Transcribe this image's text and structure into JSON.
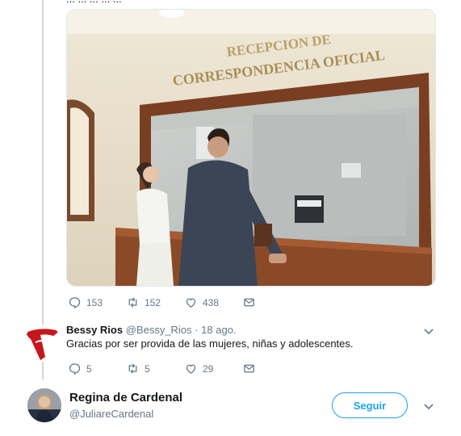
{
  "first_tweet": {
    "cut_text": "... ... ... ... ...",
    "photo": {
      "sign_line1": "RECEPCION DE",
      "sign_line2": "CORRESPONDENCIA OFICIAL"
    },
    "actions": {
      "replies": "153",
      "retweets": "152",
      "likes": "438"
    }
  },
  "reply": {
    "name": "Bessy Rios",
    "handle": "@Bessy_Rios",
    "separator": "·",
    "date": "18 ago.",
    "text": "Gracias por ser provida de las mujeres, niñas y adolescentes.",
    "actions": {
      "replies": "5",
      "retweets": "5",
      "likes": "29"
    },
    "accent_color": "#c8161d"
  },
  "account": {
    "name": "Regina de Cardenal",
    "handle": "@JuliareCardenal",
    "follow_label": "Seguir",
    "follow_color": "#1da1f2"
  },
  "icons": [
    "reply-icon",
    "retweet-icon",
    "like-icon",
    "dm-icon",
    "chevron-down-icon"
  ]
}
